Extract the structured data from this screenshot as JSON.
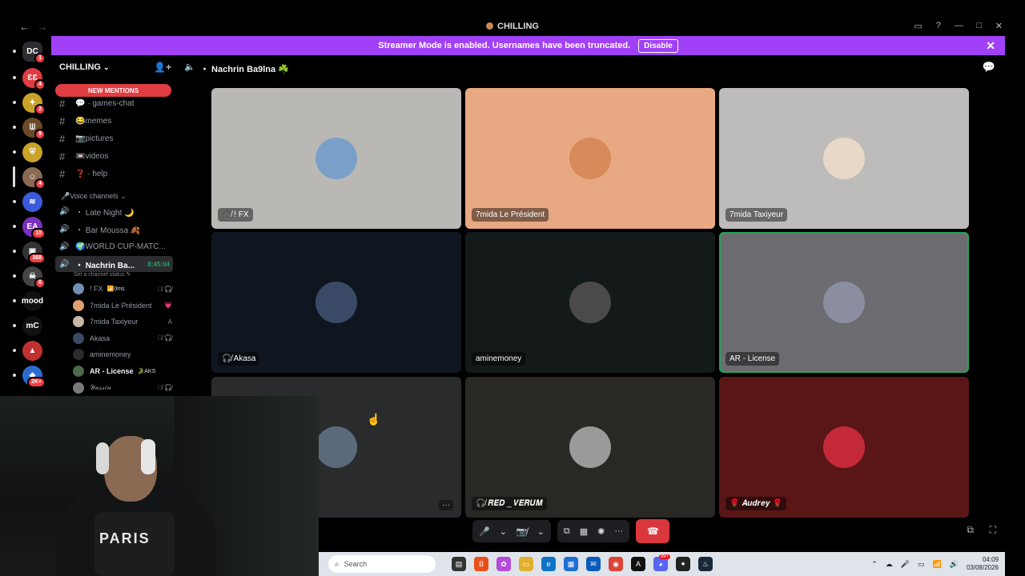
{
  "window": {
    "title": "CHILLING",
    "back": "←",
    "forward": "→",
    "controls": [
      "▭",
      "?",
      "—",
      "□",
      "✕"
    ]
  },
  "banner": {
    "text": "Streamer Mode is enabled. Usernames have been truncated.",
    "disable_label": "Disable",
    "close": "✕"
  },
  "servers": [
    {
      "label": "DC",
      "color": "#2b2d31",
      "badge": "1"
    },
    {
      "label": "ƐƐ",
      "color": "#e03d42",
      "badge": "4"
    },
    {
      "label": "✦",
      "color": "#c9a227",
      "badge": "2"
    },
    {
      "label": "ᗯ",
      "color": "#6b4a2a",
      "badge": "9"
    },
    {
      "label": "⛨",
      "color": "#c9a227",
      "badge": ""
    },
    {
      "label": "☺",
      "color": "#8a6a52",
      "badge": "4"
    },
    {
      "label": "≋",
      "color": "#3b5bdb",
      "badge": ""
    },
    {
      "label": "EA",
      "color": "#7b2fbf",
      "badge": "10"
    },
    {
      "label": "▣",
      "color": "#333",
      "badge": "368"
    },
    {
      "label": "☠",
      "color": "#444",
      "badge": "6"
    },
    {
      "label": "mood",
      "color": "#111",
      "badge": ""
    },
    {
      "label": "mC",
      "color": "#111",
      "badge": ""
    },
    {
      "label": "▲",
      "color": "#c03030",
      "badge": ""
    },
    {
      "label": "◆",
      "color": "#2d6bd1",
      "badge": "2K+"
    }
  ],
  "sidebar": {
    "guild_name": "CHILLING",
    "new_mentions": "NEW MENTIONS",
    "text_channels": [
      {
        "name": "💬 · games-chat"
      },
      {
        "name": "😂memes"
      },
      {
        "name": "📷pictures"
      },
      {
        "name": "📼videos"
      },
      {
        "name": "❓ · help"
      }
    ],
    "voice_category": "🎤Voice channels",
    "voice_channels": [
      {
        "name": "・ Late Night 🌙"
      },
      {
        "name": "・ Bar Moussa 🍂"
      },
      {
        "name": "🌍WORLD CUP-MATC..."
      },
      {
        "name": "・ Nachrin Ba...",
        "timer": "8:45:04"
      }
    ],
    "status_hint": "Set a channel status ✎",
    "members": [
      {
        "name": "! FX",
        "extra": "📶0ms",
        "flags": "🎙̸ 🎧̸",
        "color": "#6f8fb3"
      },
      {
        "name": "7mida Le Président",
        "extra": "",
        "flags": "💗",
        "color": "#e0a070"
      },
      {
        "name": "7mida Taxiyeur",
        "extra": "",
        "flags": "A",
        "color": "#c9b8a8"
      },
      {
        "name": "Akasa",
        "extra": "",
        "flags": "🎙̸ 🎧̸",
        "color": "#3a4a66"
      },
      {
        "name": "aminemoney",
        "extra": "",
        "flags": "",
        "color": "#2a2c2e"
      },
      {
        "name": "AR - License",
        "extra": "🐊AKS",
        "flags": "",
        "color": "#4a6a4a",
        "bold": true
      },
      {
        "name": "𝒴𝒶𝓈𝓈𝒾𝓃",
        "extra": "",
        "flags": "🎙̸ 🎧̸",
        "color": "#7a7a7a"
      }
    ]
  },
  "voice": {
    "header_name": "・ Nachrin Ba9lna ☘️",
    "tiles": [
      {
        "name": "🎧̸ ! FX",
        "bg": "#b9b8b5",
        "pfp": "#7aa0c9",
        "speaking": false
      },
      {
        "name": "7mida Le Président",
        "bg": "#e8a882",
        "pfp": "#d98a5a",
        "speaking": false
      },
      {
        "name": "7mida Taxiyeur",
        "bg": "#bdbcba",
        "pfp": "#e8d8c8",
        "speaking": false
      },
      {
        "name": "🎧̸ Akasa",
        "bg": "#101620",
        "pfp": "#3a4a66",
        "speaking": false
      },
      {
        "name": "aminemoney",
        "bg": "#141a19",
        "pfp": "#4a4a4a",
        "speaking": false
      },
      {
        "name": "AR - License",
        "bg": "#6c6c70",
        "pfp": "#8a8ea0",
        "speaking": true
      },
      {
        "name": "",
        "bg": "#2a2b2d",
        "pfp": "#5a6a7a",
        "speaking": false,
        "more": "···"
      },
      {
        "name": "🎧̸ 𝑹𝑬𝑫 _ 𝑽𝑬𝑹𝑼𝑴",
        "bg": "#2a2825",
        "pfp": "#9a9a9a",
        "speaking": false
      },
      {
        "name": "🌹 𝑨𝒖𝒅𝒓𝒆𝒚 🌹",
        "bg": "#5a1616",
        "pfp": "#c42a3a",
        "speaking": false
      }
    ]
  },
  "controls": {
    "mic": "🎤",
    "mic_caret": "⌄",
    "camera": "📷̸",
    "camera_caret": "⌄",
    "share": "⧉",
    "activities": "▦",
    "soundboard": "✺",
    "more": "···",
    "end_call": "☎",
    "popout": "⧉",
    "fullscreen": "⛶"
  },
  "webcam": {
    "jersey_text": "PARIS"
  },
  "taskbar": {
    "search_placeholder": "Search",
    "apps": [
      {
        "label": "▤",
        "color": "#333"
      },
      {
        "label": "B",
        "color": "#e8501c"
      },
      {
        "label": "✿",
        "color": "#b44cd8"
      },
      {
        "label": "▭",
        "color": "#e0b030"
      },
      {
        "label": "e",
        "color": "#0c74c8"
      },
      {
        "label": "▦",
        "color": "#1d6fd1"
      },
      {
        "label": "✉",
        "color": "#0a5cbd"
      },
      {
        "label": "◉",
        "color": "#db4437"
      },
      {
        "label": "A",
        "color": "#111"
      },
      {
        "label": "◕",
        "color": "#5865f2",
        "badge": "99+"
      },
      {
        "label": "✦",
        "color": "#222"
      },
      {
        "label": "♨",
        "color": "#1b2838"
      }
    ],
    "tray_icons": [
      "⌃",
      "☁",
      "🎤",
      "▭",
      "📶",
      "🔊"
    ],
    "time": "04:09",
    "date": "03/08/2026"
  }
}
